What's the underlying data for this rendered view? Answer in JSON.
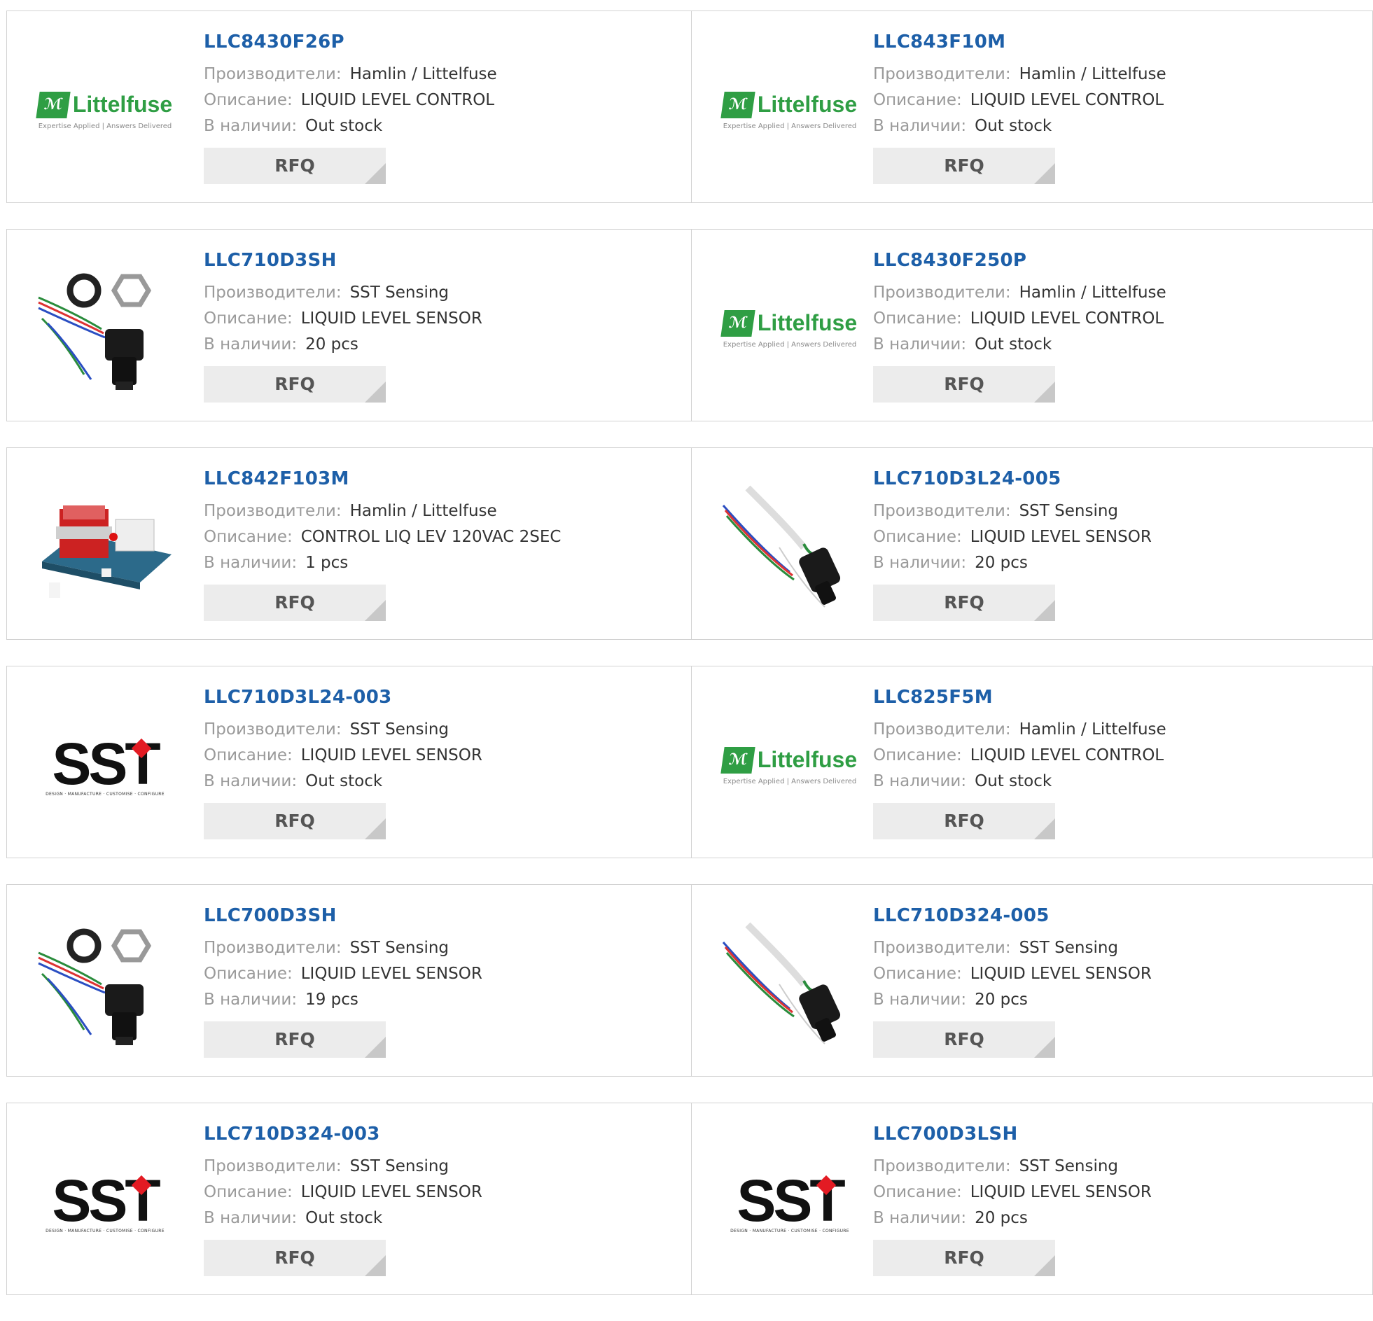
{
  "labels": {
    "manufacturer": "Производители:",
    "description": "Описание:",
    "stock": "В наличии:",
    "rfq": "RFQ"
  },
  "logos": {
    "littelfuse_word": "Littelfuse",
    "littelfuse_tag": "Expertise Applied | Answers Delivered",
    "sst_word": "SST",
    "sst_tag": "DESIGN · MANUFACTURE · CUSTOMISE · CONFIGURE"
  },
  "products": [
    {
      "pn": "LLC8430F26P",
      "manufacturer": "Hamlin / Littelfuse",
      "description": "LIQUID LEVEL CONTROL",
      "stock": "Out stock",
      "image": "littelfuse-logo"
    },
    {
      "pn": "LLC843F10M",
      "manufacturer": "Hamlin / Littelfuse",
      "description": "LIQUID LEVEL CONTROL",
      "stock": "Out stock",
      "image": "littelfuse-logo"
    },
    {
      "pn": "LLC710D3SH",
      "manufacturer": "SST Sensing",
      "description": "LIQUID LEVEL SENSOR",
      "stock": "20 pcs",
      "image": "sensor-with-nut-photo"
    },
    {
      "pn": "LLC8430F250P",
      "manufacturer": "Hamlin / Littelfuse",
      "description": "LIQUID LEVEL CONTROL",
      "stock": "Out stock",
      "image": "littelfuse-logo"
    },
    {
      "pn": "LLC842F103M",
      "manufacturer": "Hamlin / Littelfuse",
      "description": "CONTROL LIQ LEV 120VAC 2SEC",
      "stock": "1 pcs",
      "image": "control-board-photo"
    },
    {
      "pn": "LLC710D3L24-005",
      "manufacturer": "SST Sensing",
      "description": "LIQUID LEVEL SENSOR",
      "stock": "20 pcs",
      "image": "sensor-cable-photo"
    },
    {
      "pn": "LLC710D3L24-003",
      "manufacturer": "SST Sensing",
      "description": "LIQUID LEVEL SENSOR",
      "stock": "Out stock",
      "image": "sst-logo"
    },
    {
      "pn": "LLC825F5M",
      "manufacturer": "Hamlin / Littelfuse",
      "description": "LIQUID LEVEL CONTROL",
      "stock": "Out stock",
      "image": "littelfuse-logo"
    },
    {
      "pn": "LLC700D3SH",
      "manufacturer": "SST Sensing",
      "description": "LIQUID LEVEL SENSOR",
      "stock": "19 pcs",
      "image": "sensor-with-nut-photo"
    },
    {
      "pn": "LLC710D324-005",
      "manufacturer": "SST Sensing",
      "description": "LIQUID LEVEL SENSOR",
      "stock": "20 pcs",
      "image": "sensor-cable-photo"
    },
    {
      "pn": "LLC710D324-003",
      "manufacturer": "SST Sensing",
      "description": "LIQUID LEVEL SENSOR",
      "stock": "Out stock",
      "image": "sst-logo"
    },
    {
      "pn": "LLC700D3LSH",
      "manufacturer": "SST Sensing",
      "description": "LIQUID LEVEL SENSOR",
      "stock": "20 pcs",
      "image": "sst-logo"
    }
  ],
  "colors": {
    "part_number": "#1d5fa8",
    "littelfuse_green": "#2f9e44",
    "sst_red": "#e31b23"
  }
}
